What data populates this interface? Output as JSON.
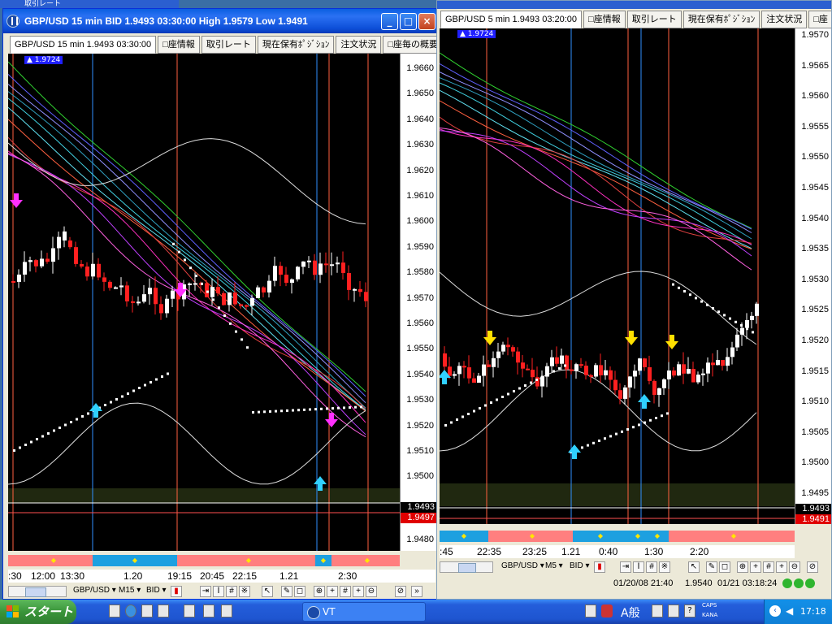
{
  "desktop": {
    "background_windows": [
      "取引レート"
    ],
    "start_label": "スタート",
    "taskbar_items": [
      {
        "label": "VT"
      }
    ],
    "tray": {
      "ime_label": "A般",
      "caps": "CAPS",
      "kana": "KANA",
      "time": "17:18"
    }
  },
  "window_left": {
    "title": "GBP/USD 15 min BID 1.9493 03:30:00 High 1.9579 Low 1.9491",
    "tabs": [
      "GBP/USD 15 min 1.9493 03:30:00",
      "□座情報",
      "取引レート",
      "現在保有ﾎﾟｼﾞｼｮﾝ",
      "注文状況",
      "□座毎の概要"
    ],
    "badge": "1.9724",
    "price_labels": [
      "1.9660",
      "1.9650",
      "1.9640",
      "1.9630",
      "1.9620",
      "1.9610",
      "1.9600",
      "1.9590",
      "1.9580",
      "1.9570",
      "1.9560",
      "1.9550",
      "1.9540",
      "1.9530",
      "1.9520",
      "1.9510",
      "1.9500",
      "1.9493",
      "1.9480"
    ],
    "price_tag_last": "1.9493",
    "price_tag_ask": "1.9497",
    "time_labels": [
      ":30",
      "12:00",
      "13:30",
      "1.20",
      "19:15",
      "20:45",
      "22:15",
      "1.21",
      "2:30"
    ],
    "toolbar": {
      "symbol": "GBP/USD",
      "timeframe": "M15",
      "side": "BID"
    }
  },
  "window_right": {
    "tabs": [
      "GBP/USD 5 min 1.9493 03:20:00",
      "□座情報",
      "取引レート",
      "現在保有ﾎﾟｼﾞｼｮﾝ",
      "注文状況",
      "□座"
    ],
    "badge": "1.9724",
    "price_labels": [
      "1.9570",
      "1.9565",
      "1.9560",
      "1.9555",
      "1.9550",
      "1.9545",
      "1.9540",
      "1.9535",
      "1.9530",
      "1.9525",
      "1.9520",
      "1.9515",
      "1.9510",
      "1.9505",
      "1.9500",
      "1.9495"
    ],
    "price_tag_last": "1.9493",
    "price_tag_ask": "1.9491",
    "time_labels": [
      ":45",
      "22:35",
      "23:25",
      "1.21",
      "0:40",
      "1:30",
      "2:20"
    ],
    "toolbar": {
      "symbol": "GBP/USD",
      "timeframe": "M5",
      "side": "BID"
    },
    "status": {
      "dates": "01/20/08 21:40",
      "price": "1.9540",
      "dates2": "01/21 03:18:24"
    }
  },
  "colors": {
    "bull": "#ffffff",
    "bear": "#ff2020",
    "cyan_line": "#30c0e0",
    "magenta": "#ff30c0",
    "green_ma": "#30d030",
    "up_arrow": "#30d0ff",
    "down_arrow_left": "#ff30ff",
    "down_arrow_right": "#ffe000"
  }
}
